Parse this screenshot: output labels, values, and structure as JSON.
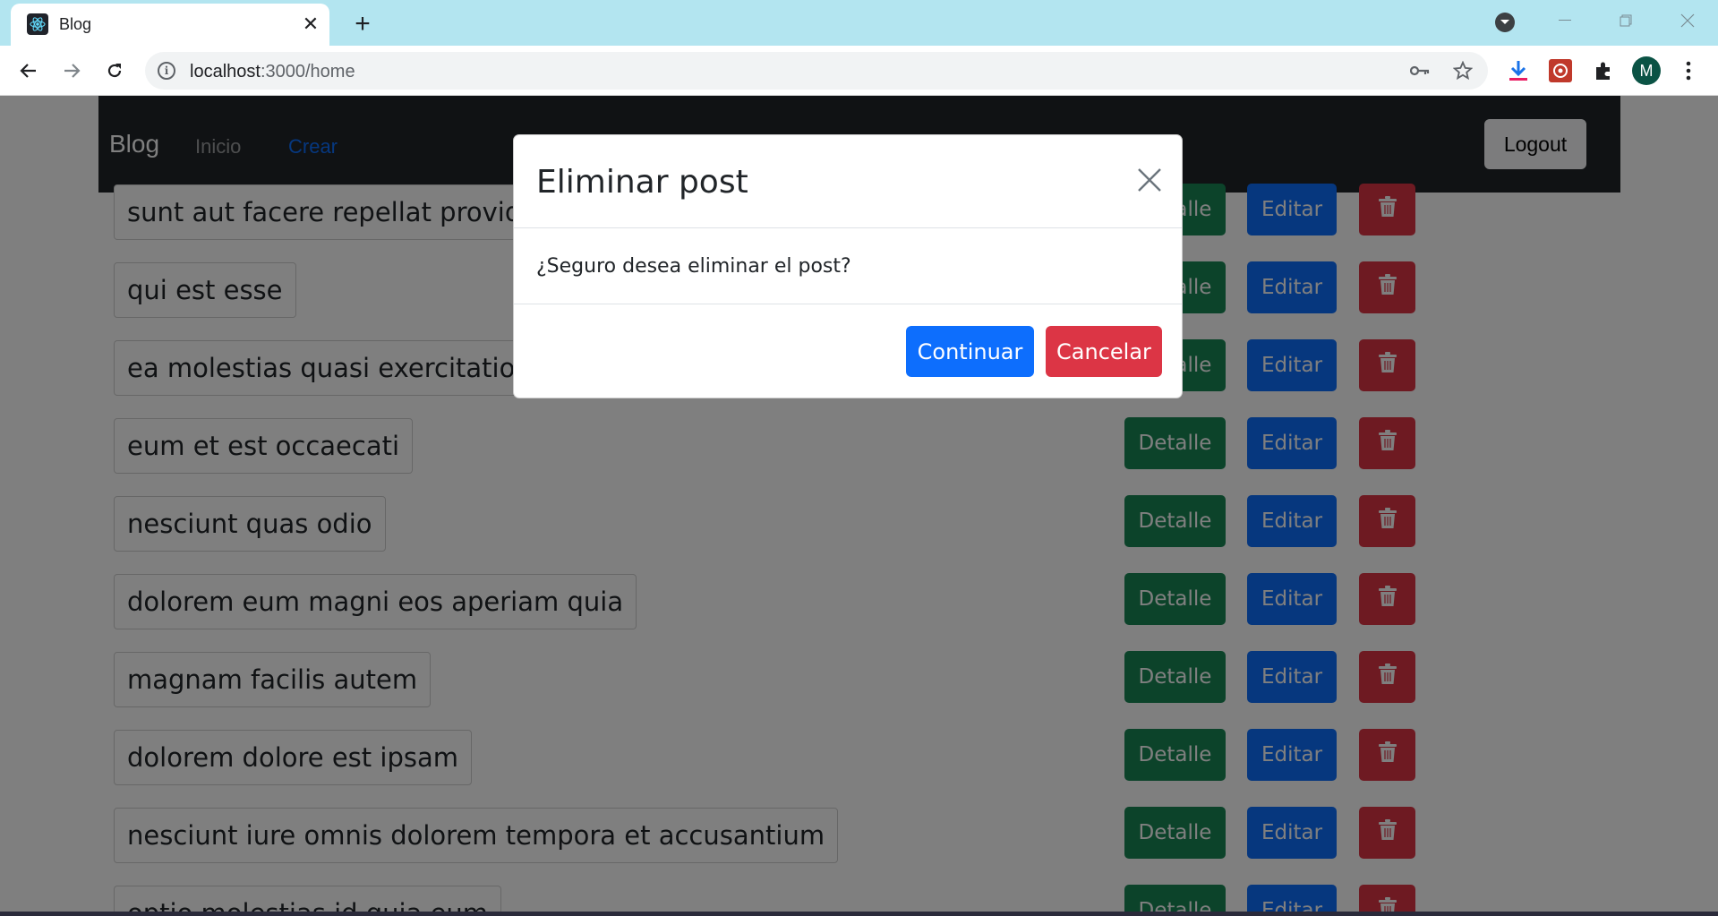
{
  "browser": {
    "tab_title": "Blog",
    "url_host": "localhost",
    "url_path": ":3000/home",
    "new_tab_symbol": "+",
    "close_symbol": "✕",
    "icons": [
      "react-favicon-icon",
      "back-arrow-icon",
      "forward-arrow-icon",
      "reload-icon",
      "site-info-icon",
      "key-icon",
      "star-icon",
      "download-icon",
      "extension-icon",
      "puzzle-icon",
      "menu-kebab-icon"
    ],
    "avatar_letter": "M"
  },
  "navbar": {
    "brand": "Blog",
    "links": [
      {
        "label": "Inicio",
        "active": false
      },
      {
        "label": "Crear",
        "active": true
      }
    ],
    "logout_label": "Logout"
  },
  "posts": [
    {
      "title": "sunt aut facere repellat provident occaecati excepturi optio reprehenderit"
    },
    {
      "title": "qui est esse"
    },
    {
      "title": "ea molestias quasi exercitationem repellat qui ipsa sit aut"
    },
    {
      "title": "eum et est occaecati"
    },
    {
      "title": "nesciunt quas odio"
    },
    {
      "title": "dolorem eum magni eos aperiam quia"
    },
    {
      "title": "magnam facilis autem"
    },
    {
      "title": "dolorem dolore est ipsam"
    },
    {
      "title": "nesciunt iure omnis dolorem tempora et accusantium"
    },
    {
      "title": "optio molestias id quia eum"
    }
  ],
  "row_buttons": {
    "detalle": "Detalle",
    "editar": "Editar",
    "delete_icon": "trash-icon"
  },
  "modal": {
    "title": "Eliminar post",
    "body": "¿Seguro desea eliminar el post?",
    "confirm_label": "Continuar",
    "cancel_label": "Cancelar"
  },
  "colors": {
    "success": "#198754",
    "primary": "#0d6efd",
    "danger": "#dc3545",
    "navbar": "#212529",
    "tabstrip": "#b3e5f0"
  }
}
